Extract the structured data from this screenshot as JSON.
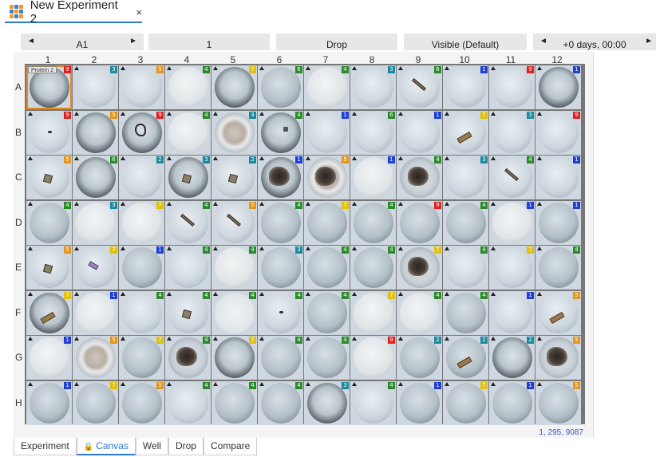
{
  "document_tab": {
    "title": "New Experiment 2",
    "close_glyph": "×",
    "icon": "plate-app-icon"
  },
  "nav": {
    "well": {
      "label": "A1",
      "left_glyph": "◄",
      "right_glyph": "►"
    },
    "plate": {
      "label": "1"
    },
    "view": {
      "label": "Drop"
    },
    "imaging": {
      "label": "Visible (Default)"
    },
    "time": {
      "label": "+0 days, 00:00",
      "left_glyph": "◄",
      "right_glyph": "►"
    }
  },
  "plate": {
    "protein_tag": "Protein 2",
    "columns": [
      "1",
      "2",
      "3",
      "4",
      "5",
      "6",
      "7",
      "8",
      "9",
      "10",
      "11",
      "12"
    ],
    "rows": [
      "A",
      "B",
      "C",
      "D",
      "E",
      "F",
      "G",
      "H"
    ],
    "selected_well": "A1",
    "coords_readout": "1, 295, 9087",
    "badge_colors": {
      "1": "#1f3fd6",
      "2": "#1c8a9e",
      "3": "#1c8a9e",
      "4": "#2b8a2b",
      "5": "#e3961a",
      "6": "#2b8a2b",
      "7": "#e0c010",
      "8": "#1c8a9e",
      "9": "#e02020"
    },
    "wells": {
      "A": [
        [
          9,
          "dark",
          "none"
        ],
        [
          3,
          "light",
          "none"
        ],
        [
          5,
          "light",
          "none"
        ],
        [
          4,
          "speckle",
          "none"
        ],
        [
          7,
          "dark",
          "none"
        ],
        [
          6,
          "medium",
          "none"
        ],
        [
          4,
          "speckle",
          "none"
        ],
        [
          3,
          "light",
          "none"
        ],
        [
          6,
          "light",
          "needle"
        ],
        [
          1,
          "light",
          "none"
        ],
        [
          9,
          "light",
          "none"
        ],
        [
          1,
          "dark",
          "none"
        ]
      ],
      "B": [
        [
          9,
          "light",
          "dot"
        ],
        [
          5,
          "dark",
          "none"
        ],
        [
          9,
          "dark",
          "loop"
        ],
        [
          4,
          "speckle",
          "none"
        ],
        [
          3,
          "ring",
          "none"
        ],
        [
          4,
          "dark",
          "small"
        ],
        [
          1,
          "light",
          "none"
        ],
        [
          6,
          "light",
          "none"
        ],
        [
          1,
          "light",
          "none"
        ],
        [
          7,
          "light",
          "plate"
        ],
        [
          3,
          "light",
          "none"
        ],
        [
          9,
          "light",
          "none"
        ]
      ],
      "C": [
        [
          5,
          "light",
          "cube"
        ],
        [
          6,
          "dark",
          "none"
        ],
        [
          2,
          "light",
          "none"
        ],
        [
          3,
          "dark",
          "cube"
        ],
        [
          2,
          "light",
          "cube"
        ],
        [
          1,
          "dark",
          "blob"
        ],
        [
          5,
          "ring",
          "blob"
        ],
        [
          1,
          "speckle",
          "none"
        ],
        [
          4,
          "blob",
          "blob"
        ],
        [
          3,
          "light",
          "none"
        ],
        [
          4,
          "light",
          "needle"
        ],
        [
          1,
          "light",
          "none"
        ]
      ],
      "D": [
        [
          4,
          "medium",
          "none"
        ],
        [
          3,
          "speckle",
          "none"
        ],
        [
          7,
          "speckle",
          "none"
        ],
        [
          4,
          "light",
          "needle"
        ],
        [
          5,
          "light",
          "needle"
        ],
        [
          4,
          "medium",
          "none"
        ],
        [
          7,
          "medium",
          "none"
        ],
        [
          4,
          "medium",
          "none"
        ],
        [
          9,
          "medium",
          "none"
        ],
        [
          4,
          "medium",
          "none"
        ],
        [
          1,
          "speckle",
          "none"
        ],
        [
          1,
          "medium",
          "none"
        ]
      ],
      "E": [
        [
          5,
          "light",
          "cube"
        ],
        [
          7,
          "light",
          "pink"
        ],
        [
          1,
          "medium",
          "none"
        ],
        [
          4,
          "light",
          "none"
        ],
        [
          4,
          "speckle",
          "none"
        ],
        [
          3,
          "medium",
          "none"
        ],
        [
          4,
          "medium",
          "none"
        ],
        [
          4,
          "medium",
          "none"
        ],
        [
          7,
          "blob",
          "blob"
        ],
        [
          4,
          "light",
          "none"
        ],
        [
          7,
          "light",
          "none"
        ],
        [
          4,
          "medium",
          "none"
        ]
      ],
      "F": [
        [
          7,
          "dark",
          "plate"
        ],
        [
          1,
          "speckle",
          "none"
        ],
        [
          4,
          "light",
          "none"
        ],
        [
          4,
          "light",
          "cube"
        ],
        [
          4,
          "pale",
          "none"
        ],
        [
          4,
          "light",
          "dot"
        ],
        [
          4,
          "medium",
          "none"
        ],
        [
          7,
          "speckle",
          "none"
        ],
        [
          4,
          "speckle",
          "none"
        ],
        [
          4,
          "medium",
          "none"
        ],
        [
          1,
          "light",
          "none"
        ],
        [
          5,
          "light",
          "plate"
        ]
      ],
      "G": [
        [
          1,
          "speckle",
          "none"
        ],
        [
          5,
          "ring",
          "none"
        ],
        [
          7,
          "medium",
          "none"
        ],
        [
          4,
          "blob",
          "blob"
        ],
        [
          7,
          "dark",
          "none"
        ],
        [
          4,
          "medium",
          "none"
        ],
        [
          4,
          "medium",
          "none"
        ],
        [
          9,
          "speckle",
          "none"
        ],
        [
          2,
          "medium",
          "none"
        ],
        [
          2,
          "medium",
          "plate"
        ],
        [
          2,
          "dark",
          "none"
        ],
        [
          5,
          "blob",
          "blob"
        ]
      ],
      "H": [
        [
          1,
          "medium",
          "none"
        ],
        [
          7,
          "medium",
          "none"
        ],
        [
          5,
          "medium",
          "none"
        ],
        [
          4,
          "light",
          "none"
        ],
        [
          4,
          "medium",
          "none"
        ],
        [
          4,
          "medium",
          "none"
        ],
        [
          3,
          "dark",
          "none"
        ],
        [
          4,
          "light",
          "none"
        ],
        [
          1,
          "medium",
          "none"
        ],
        [
          7,
          "medium",
          "none"
        ],
        [
          1,
          "medium",
          "none"
        ],
        [
          5,
          "medium",
          "none"
        ]
      ]
    }
  },
  "bottom_tabs": [
    {
      "label": "Experiment",
      "active": false
    },
    {
      "label": "Canvas",
      "active": true,
      "icon": "lock-icon"
    },
    {
      "label": "Well",
      "active": false
    },
    {
      "label": "Drop",
      "active": false
    },
    {
      "label": "Compare",
      "active": false
    }
  ]
}
